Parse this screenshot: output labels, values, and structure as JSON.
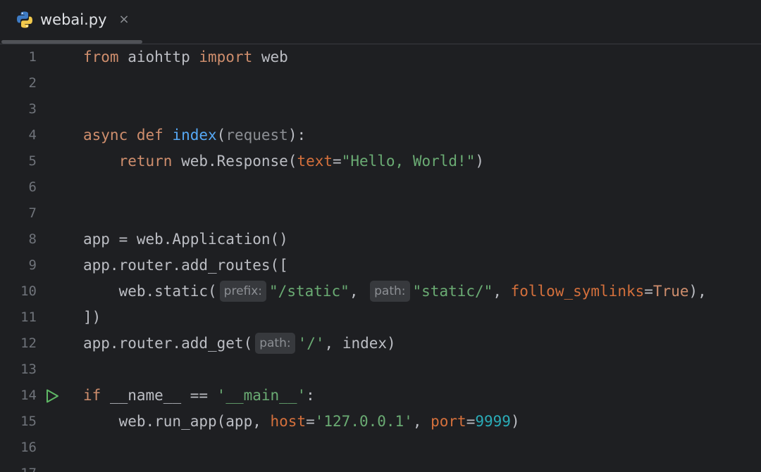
{
  "tab": {
    "title": "webai.py",
    "icon": "python-file-icon",
    "close": "×"
  },
  "colors": {
    "background": "#1e1f22",
    "keyword": "#cf8e6d",
    "function": "#56a8f5",
    "string": "#6aab73",
    "number": "#2aacb8",
    "kwarg": "#d5703c",
    "text": "#bcbec4",
    "run_icon": "#5fb865"
  },
  "lines": [
    {
      "n": "1",
      "tokens": [
        {
          "t": "kw",
          "v": "from"
        },
        {
          "t": "plain",
          "v": " aiohttp "
        },
        {
          "t": "kw",
          "v": "import"
        },
        {
          "t": "plain",
          "v": " web"
        }
      ]
    },
    {
      "n": "2",
      "tokens": []
    },
    {
      "n": "3",
      "tokens": []
    },
    {
      "n": "4",
      "tokens": [
        {
          "t": "kw",
          "v": "async def "
        },
        {
          "t": "fn",
          "v": "index"
        },
        {
          "t": "plain",
          "v": "("
        },
        {
          "t": "param",
          "v": "request"
        },
        {
          "t": "plain",
          "v": "):"
        }
      ]
    },
    {
      "n": "5",
      "tokens": [
        {
          "t": "plain",
          "v": "    "
        },
        {
          "t": "kw",
          "v": "return"
        },
        {
          "t": "plain",
          "v": " web.Response("
        },
        {
          "t": "kwarg",
          "v": "text"
        },
        {
          "t": "plain",
          "v": "="
        },
        {
          "t": "str",
          "v": "\"Hello, World!\""
        },
        {
          "t": "plain",
          "v": ")"
        }
      ]
    },
    {
      "n": "6",
      "tokens": []
    },
    {
      "n": "7",
      "tokens": []
    },
    {
      "n": "8",
      "tokens": [
        {
          "t": "plain",
          "v": "app = web.Application()"
        }
      ]
    },
    {
      "n": "9",
      "tokens": [
        {
          "t": "plain",
          "v": "app.router.add_routes(["
        }
      ]
    },
    {
      "n": "10",
      "tokens": [
        {
          "t": "plain",
          "v": "    web.static("
        },
        {
          "t": "hint",
          "v": "prefix:"
        },
        {
          "t": "str",
          "v": "\"/static\""
        },
        {
          "t": "plain",
          "v": ", "
        },
        {
          "t": "hint",
          "v": "path:"
        },
        {
          "t": "str",
          "v": "\"static/\""
        },
        {
          "t": "plain",
          "v": ", "
        },
        {
          "t": "kwarg",
          "v": "follow_symlinks"
        },
        {
          "t": "plain",
          "v": "="
        },
        {
          "t": "kw",
          "v": "True"
        },
        {
          "t": "plain",
          "v": "),"
        }
      ]
    },
    {
      "n": "11",
      "tokens": [
        {
          "t": "plain",
          "v": "])"
        }
      ]
    },
    {
      "n": "12",
      "tokens": [
        {
          "t": "plain",
          "v": "app.router.add_get("
        },
        {
          "t": "hint",
          "v": "path:"
        },
        {
          "t": "str",
          "v": "'/'"
        },
        {
          "t": "plain",
          "v": ", index)"
        }
      ]
    },
    {
      "n": "13",
      "tokens": []
    },
    {
      "n": "14",
      "run": true,
      "tokens": [
        {
          "t": "kw",
          "v": "if"
        },
        {
          "t": "plain",
          "v": " __name__ == "
        },
        {
          "t": "str",
          "v": "'__main__'"
        },
        {
          "t": "plain",
          "v": ":"
        }
      ]
    },
    {
      "n": "15",
      "tokens": [
        {
          "t": "plain",
          "v": "    web.run_app(app, "
        },
        {
          "t": "kwarg",
          "v": "host"
        },
        {
          "t": "plain",
          "v": "="
        },
        {
          "t": "str",
          "v": "'127.0.0.1'"
        },
        {
          "t": "plain",
          "v": ", "
        },
        {
          "t": "kwarg",
          "v": "port"
        },
        {
          "t": "plain",
          "v": "="
        },
        {
          "t": "num",
          "v": "9999"
        },
        {
          "t": "plain",
          "v": ")"
        }
      ]
    },
    {
      "n": "16",
      "tokens": []
    },
    {
      "n": "17",
      "tokens": []
    }
  ]
}
